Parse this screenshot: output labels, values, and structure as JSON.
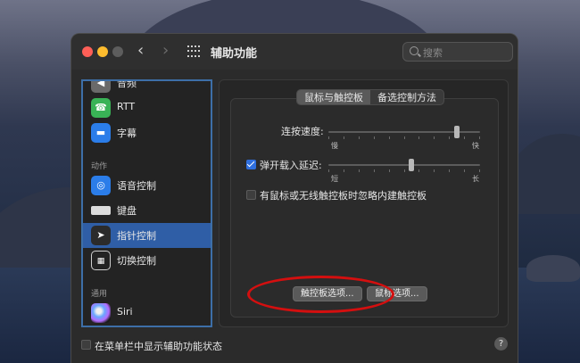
{
  "window": {
    "title": "辅助功能"
  },
  "search": {
    "placeholder": "搜索"
  },
  "sidebar": {
    "items": [
      {
        "label": "音频",
        "icon": "speaker-icon",
        "section": "hearing"
      },
      {
        "label": "RTT",
        "icon": "rtt-icon",
        "section": "hearing"
      },
      {
        "label": "字幕",
        "icon": "captions-icon",
        "section": "hearing"
      },
      {
        "label": "语音控制",
        "icon": "voice-control-icon",
        "section": "motor"
      },
      {
        "label": "键盘",
        "icon": "keyboard-icon",
        "section": "motor"
      },
      {
        "label": "指针控制",
        "icon": "pointer-icon",
        "section": "motor",
        "selected": true
      },
      {
        "label": "切换控制",
        "icon": "switch-control-icon",
        "section": "motor"
      },
      {
        "label": "Siri",
        "icon": "siri-icon",
        "section": "general"
      }
    ],
    "sections": {
      "motor": "动作",
      "general": "通用"
    }
  },
  "tabs": {
    "trackpad": "鼠标与触控板",
    "alternate": "备选控制方法"
  },
  "settings": {
    "double_click_speed": {
      "label": "连按速度:",
      "min_label": "慢",
      "max_label": "快",
      "value": 0.86
    },
    "spring_loading": {
      "label": "弹开载入延迟:",
      "checked": true,
      "min_label": "短",
      "max_label": "长",
      "value": 0.55
    },
    "ignore_trackpad": {
      "label": "有鼠标或无线触控板时忽略内建触控板",
      "checked": false
    }
  },
  "buttons": {
    "trackpad_options": "触控板选项...",
    "mouse_options": "鼠标选项..."
  },
  "footer": {
    "menu_status": "在菜单栏中显示辅助功能状态",
    "help": "?"
  },
  "annotation_color": "#d40f0f"
}
